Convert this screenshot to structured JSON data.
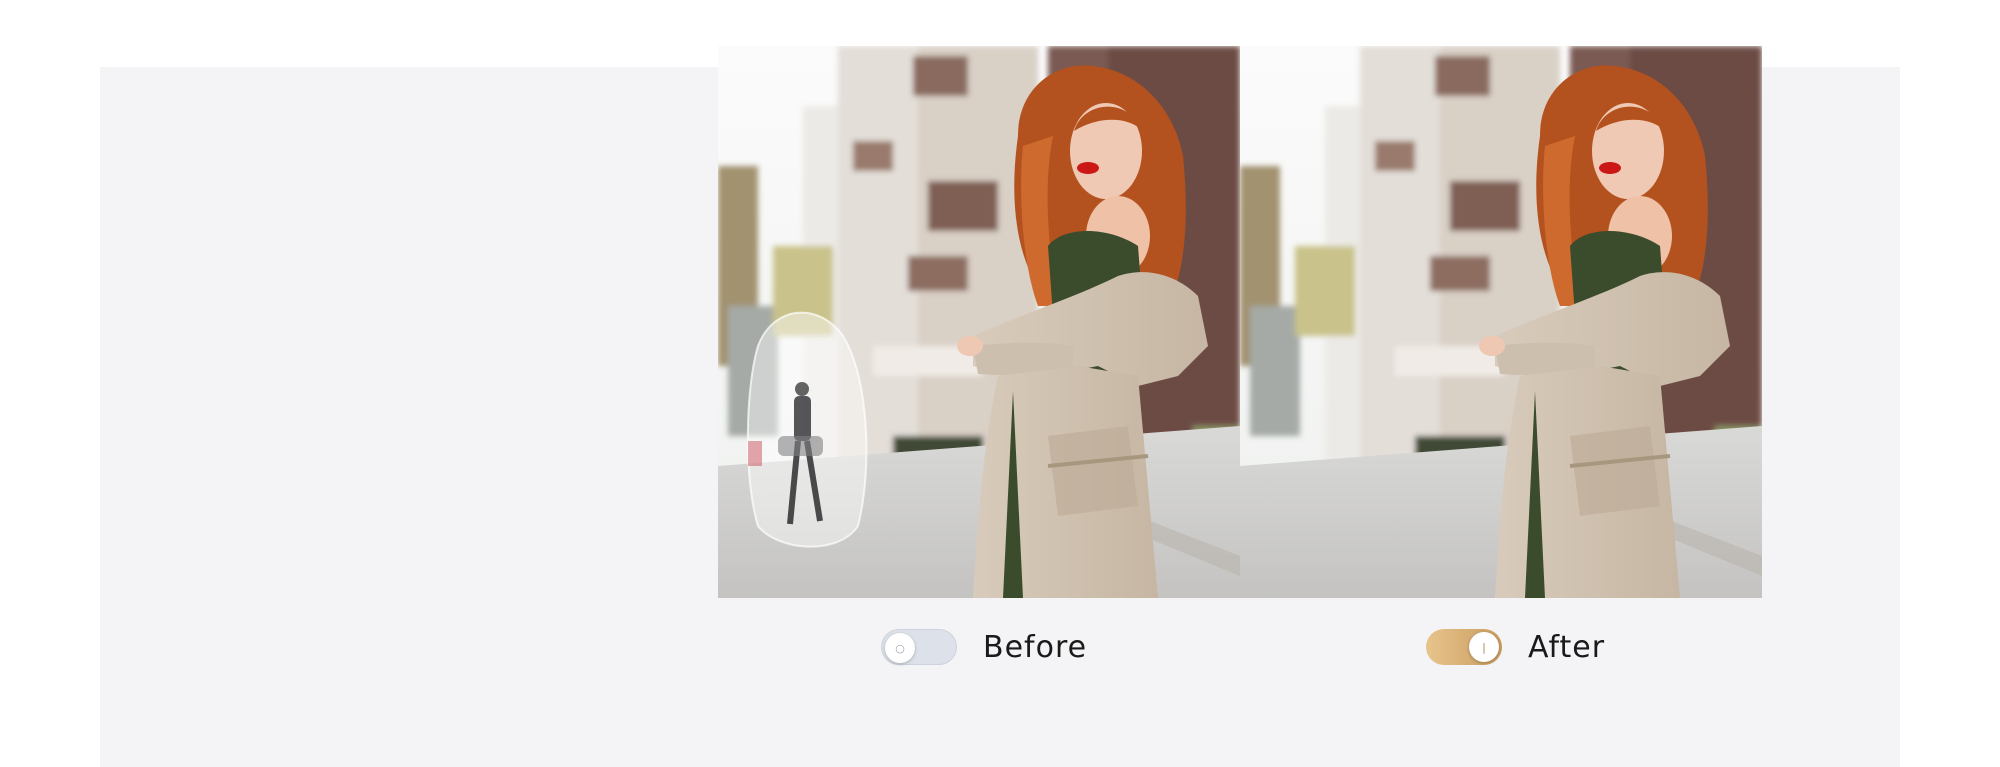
{
  "compare": {
    "before": {
      "label": "Before",
      "toggle_state": "off",
      "toggle_icon": "ring-icon",
      "toggle_glyph": "○",
      "image_alt": "Red-haired woman in beige trench coat on street, pedestrian in background highlighted for removal"
    },
    "after": {
      "label": "After",
      "toggle_state": "on",
      "toggle_icon": "bar-icon",
      "toggle_glyph": "|",
      "image_alt": "Red-haired woman in beige trench coat on street, background pedestrian removed"
    }
  },
  "colors": {
    "panel_bg": "#f4f4f6",
    "toggle_on": "#d4ad72",
    "toggle_off": "#dde2ea",
    "label_text": "#1a1a1a"
  }
}
